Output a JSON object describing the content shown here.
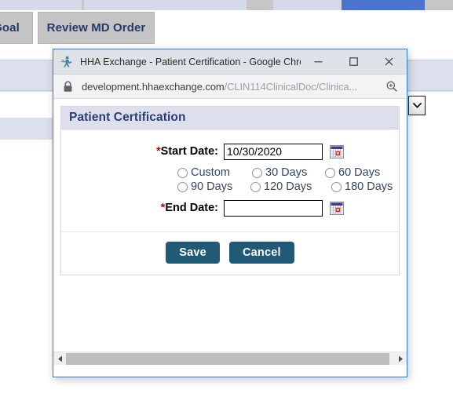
{
  "background": {
    "tabs": [
      {
        "name": "goal",
        "label": "Goal"
      },
      {
        "name": "review-md-order",
        "label": "Review MD Order"
      }
    ],
    "dropdown_icon": "chevron-down-icon",
    "colors": {
      "tab_bg": "#c4c4c4",
      "tab_text": "#26396b",
      "strip": "#d4dae8",
      "strip_accent": "#4a73cd",
      "band": "#dbe0ec"
    }
  },
  "browser_window": {
    "favicon": "hha-exchange-runner-icon",
    "title": "HHA Exchange - Patient Certification - Google Chrome",
    "controls": {
      "minimize": "minimize-icon",
      "maximize": "maximize-icon",
      "close": "close-icon"
    },
    "address_bar": {
      "security_icon": "lock-icon",
      "url_host": "development.hhaexchange.com",
      "url_path": "/CLIN114ClinicalDoc/Clinica...",
      "zoom_icon": "zoom-in-icon"
    },
    "scrollbar": {
      "left_arrow": "arrow-left-icon",
      "right_arrow": "arrow-right-icon"
    }
  },
  "dialog": {
    "heading": "Patient Certification",
    "start_date": {
      "label_star": "*",
      "label": "Start Date:",
      "value": "10/30/2020",
      "placeholder": "",
      "calendar_icon": "calendar-icon"
    },
    "end_date": {
      "label_star": "*",
      "label": "End Date:",
      "value": "",
      "placeholder": "",
      "calendar_icon": "calendar-icon"
    },
    "duration_options": [
      {
        "id": "custom",
        "label": "Custom",
        "selected": false
      },
      {
        "id": "30days",
        "label": "30 Days",
        "selected": false
      },
      {
        "id": "60days",
        "label": "60 Days",
        "selected": false
      },
      {
        "id": "90days",
        "label": "90 Days",
        "selected": false
      },
      {
        "id": "120days",
        "label": "120 Days",
        "selected": false
      },
      {
        "id": "180days",
        "label": "180 Days",
        "selected": false
      }
    ],
    "buttons": {
      "save": "Save",
      "cancel": "Cancel"
    },
    "colors": {
      "header_bg": "#dde0ec",
      "header_text": "#2c3c77",
      "button_bg": "#215a77",
      "required_star": "#cc0000",
      "radio_label": "#36465e"
    }
  }
}
